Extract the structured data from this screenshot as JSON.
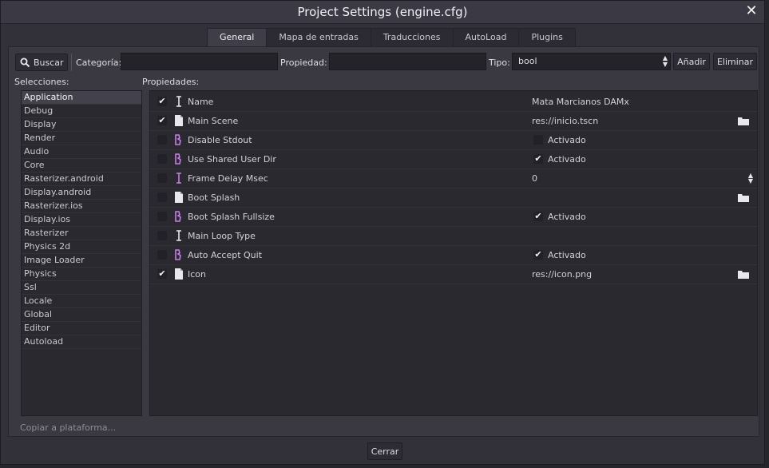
{
  "window": {
    "title": "Project Settings (engine.cfg)"
  },
  "tabs": [
    {
      "label": "General",
      "active": true
    },
    {
      "label": "Mapa de entradas"
    },
    {
      "label": "Traducciones"
    },
    {
      "label": "AutoLoad"
    },
    {
      "label": "Plugins"
    }
  ],
  "toolbar": {
    "search_label": "Buscar",
    "category_label": "Categoría:",
    "category_value": "",
    "property_label": "Propiedad:",
    "property_value": "",
    "type_label": "Tipo:",
    "type_value": "bool",
    "add_label": "Añadir",
    "remove_label": "Eliminar"
  },
  "sections": {
    "heading": "Selecciones:",
    "items": [
      "Application",
      "Debug",
      "Display",
      "Render",
      "Audio",
      "Core",
      "Rasterizer.android",
      "Display.android",
      "Rasterizer.ios",
      "Display.ios",
      "Rasterizer",
      "Physics 2d",
      "Image Loader",
      "Physics",
      "Ssl",
      "Locale",
      "Global",
      "Editor",
      "Autoload"
    ],
    "selected": "Application"
  },
  "properties": {
    "heading": "Propiedades:",
    "rows": [
      {
        "name": "Name",
        "override": true,
        "type_icon": "text-cursor-icon",
        "value": "Mata Marcianos DAMx"
      },
      {
        "name": "Main Scene",
        "override": true,
        "type_icon": "file-icon",
        "value": "res://inicio.tscn",
        "folder": true
      },
      {
        "name": "Disable Stdout",
        "override": false,
        "type_icon": "bool-icon",
        "bool_checked": false,
        "bool_label": "Activado"
      },
      {
        "name": "Use Shared User Dir",
        "override": false,
        "type_icon": "bool-icon",
        "bool_checked": true,
        "bool_label": "Activado"
      },
      {
        "name": "Frame Delay Msec",
        "override": false,
        "type_icon": "int-icon",
        "value": "0",
        "spinner": true
      },
      {
        "name": "Boot Splash",
        "override": false,
        "type_icon": "file-icon",
        "value": "",
        "folder": true
      },
      {
        "name": "Boot Splash Fullsize",
        "override": false,
        "type_icon": "bool-icon",
        "bool_checked": true,
        "bool_label": "Activado"
      },
      {
        "name": "Main Loop Type",
        "override": false,
        "type_icon": "text-cursor-icon",
        "value": ""
      },
      {
        "name": "Auto Accept Quit",
        "override": false,
        "type_icon": "bool-icon",
        "bool_checked": true,
        "bool_label": "Activado"
      },
      {
        "name": "Icon",
        "override": true,
        "type_icon": "file-icon",
        "value": "res://icon.png",
        "folder": true
      }
    ]
  },
  "footer": {
    "copy_label": "Copiar a plataforma...",
    "close_label": "Cerrar"
  },
  "colors": {
    "background": "#32313a",
    "panel": "#2a2930",
    "accent_bool": "#c97ee8",
    "text": "#d8d8dc"
  }
}
